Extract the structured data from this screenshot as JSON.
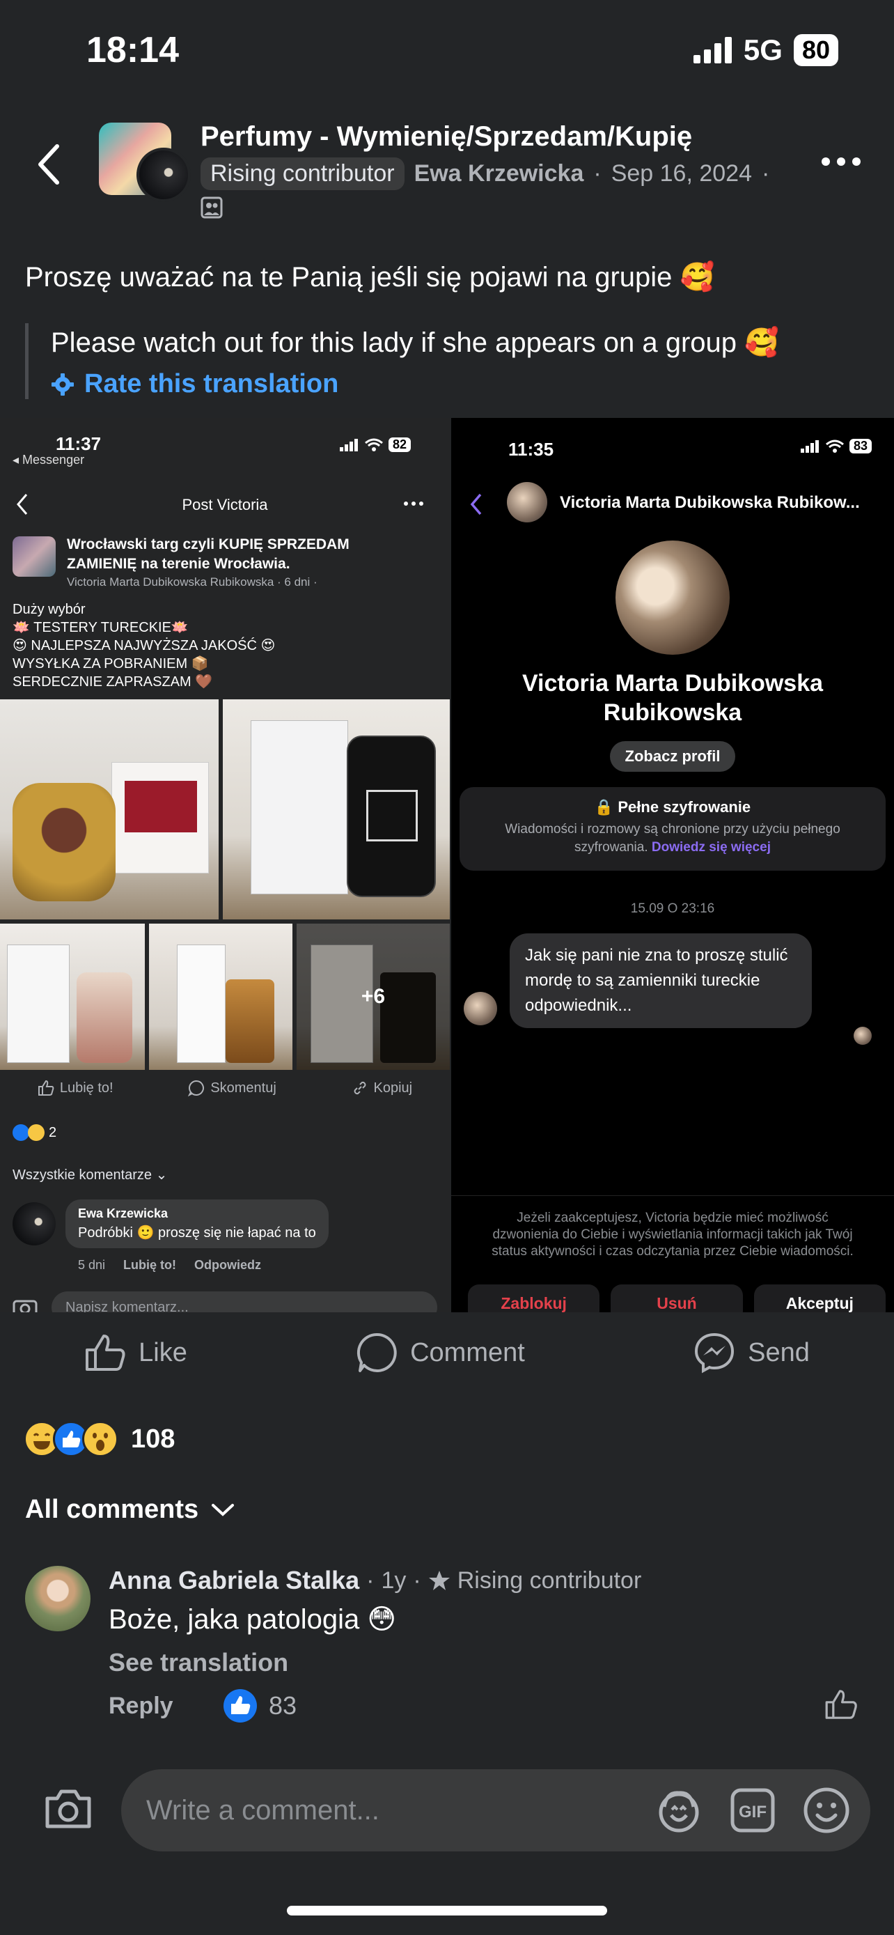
{
  "status_bar": {
    "time": "18:14",
    "network": "5G",
    "battery": "80"
  },
  "header": {
    "group_name": "Perfumy - Wymienię/Sprzedam/Kupię",
    "badge": "Rising contributor",
    "author": "Ewa Krzewicka",
    "date": "Sep 16, 2024",
    "separator": "·"
  },
  "post": {
    "text": "Proszę uważać na te Panią jeśli się pojawi na grupie 🥰",
    "translation": "Please watch out for this lady if she appears on a group 🥰",
    "rate_translation": "Rate this translation"
  },
  "left_screenshot": {
    "time": "11:37",
    "back_app": "◂ Messenger",
    "battery": "82",
    "nav_title": "Post Victoria",
    "group_name": "Wrocławski targ czyli KUPIĘ SPRZEDAM ZAMIENIĘ na terenie Wrocławia.",
    "group_meta": "Victoria Marta Dubikowska Rubikowska · 6 dni ·",
    "body_lines": [
      "Duży wybór",
      "🪷 TESTERY TURECKIE🪷",
      "😍 NAJLEPSZA NAJWYŻSZA JAKOŚĆ 😍",
      "WYSYŁKA ZA POBRANIEM 📦",
      "SERDECZNIE ZAPRASZAM 🤎"
    ],
    "more_photos": "+6",
    "actions": {
      "like": "Lubię to!",
      "comment": "Skomentuj",
      "copy": "Kopiuj"
    },
    "reaction_count": "2",
    "all_comments": "Wszystkie komentarze ⌄",
    "comment": {
      "author": "Ewa Krzewicka",
      "text": "Podróbki 🙂 proszę się nie łapać na to",
      "time": "5 dni",
      "like": "Lubię to!",
      "reply": "Odpowiedz"
    },
    "input_placeholder": "Napisz komentarz..."
  },
  "right_screenshot": {
    "time": "11:35",
    "battery": "83",
    "contact_name_top": "Victoria Marta Dubikowska Rubikow...",
    "contact_name": "Victoria Marta Dubikowska Rubikowska",
    "profile_button": "Zobacz profil",
    "encryption_title": "🔒 Pełne szyfrowanie",
    "encryption_text": "Wiadomości i rozmowy są chronione przy użyciu pełnego szyfrowania.",
    "encryption_link": "Dowiedz się więcej",
    "date": "15.09 O 23:16",
    "message": "Jak się pani nie zna to proszę stulić mordę to są zamienniki tureckie odpowiednik...",
    "notice": "Jeżeli zaakceptujesz, Victoria będzie mieć możliwość dzwonienia do Ciebie i wyświetlania informacji takich jak Twój status aktywności i czas odczytania przez Ciebie wiadomości.",
    "buttons": {
      "block": "Zablokuj",
      "delete": "Usuń",
      "accept": "Akceptuj"
    }
  },
  "actions": {
    "like": "Like",
    "comment": "Comment",
    "send": "Send"
  },
  "reactions": {
    "count": "108"
  },
  "comments_filter": "All comments",
  "comment": {
    "author": "Anna Gabriela Stalka",
    "age": "1y",
    "badge": "Rising contributor",
    "text": "Boże, jaka patologia 😳",
    "see_translation": "See translation",
    "reply": "Reply",
    "likes": "83"
  },
  "composer": {
    "placeholder": "Write a comment..."
  },
  "colors": {
    "accent": "#4aa3ff",
    "like_blue": "#1877f2",
    "background": "#232527",
    "messenger_purple": "#8b6cf2"
  }
}
